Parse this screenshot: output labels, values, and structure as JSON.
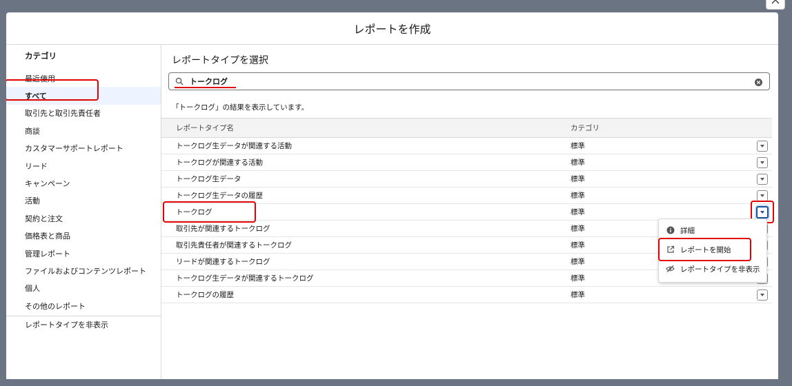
{
  "modal": {
    "title": "レポートを作成"
  },
  "sidebar": {
    "heading": "カテゴリ",
    "items": [
      {
        "label": "最近使用"
      },
      {
        "label": "すべて"
      },
      {
        "label": "取引先と取引先責任者"
      },
      {
        "label": "商談"
      },
      {
        "label": "カスタマーサポートレポート"
      },
      {
        "label": "リード"
      },
      {
        "label": "キャンペーン"
      },
      {
        "label": "活動"
      },
      {
        "label": "契約と注文"
      },
      {
        "label": "価格表と商品"
      },
      {
        "label": "管理レポート"
      },
      {
        "label": "ファイルおよびコンテンツレポート"
      },
      {
        "label": "個人"
      },
      {
        "label": "その他のレポート"
      }
    ],
    "selected_index": 1,
    "footer": "レポートタイプを非表示"
  },
  "main": {
    "title": "レポートタイプを選択",
    "search": {
      "value": "トークログ",
      "placeholder": ""
    },
    "result_note": "「トークログ」の結果を表示しています。",
    "table": {
      "headers": [
        "レポートタイプ名",
        "カテゴリ"
      ],
      "rows": [
        {
          "name": "トークログ生データが関連する活動",
          "category": "標準"
        },
        {
          "name": "トークログが関連する活動",
          "category": "標準"
        },
        {
          "name": "トークログ生データ",
          "category": "標準"
        },
        {
          "name": "トークログ生データの履歴",
          "category": "標準"
        },
        {
          "name": "トークログ",
          "category": "標準"
        },
        {
          "name": "取引先が関連するトークログ",
          "category": "標準"
        },
        {
          "name": "取引先責任者が関連するトークログ",
          "category": "標準"
        },
        {
          "name": "リードが関連するトークログ",
          "category": "標準"
        },
        {
          "name": "トークログ生データが関連するトークログ",
          "category": "標準"
        },
        {
          "name": "トークログの履歴",
          "category": "標準"
        }
      ],
      "active_row_index": 4
    },
    "menu": {
      "items": [
        {
          "label": "詳細",
          "icon": "info-icon"
        },
        {
          "label": "レポートを開始",
          "icon": "external-link-icon"
        },
        {
          "label": "レポートタイプを非表示",
          "icon": "eye-slash-icon"
        }
      ]
    }
  },
  "colors": {
    "highlight": "#e00000",
    "backdrop": "#6b7483",
    "active_border": "#1b5297"
  }
}
